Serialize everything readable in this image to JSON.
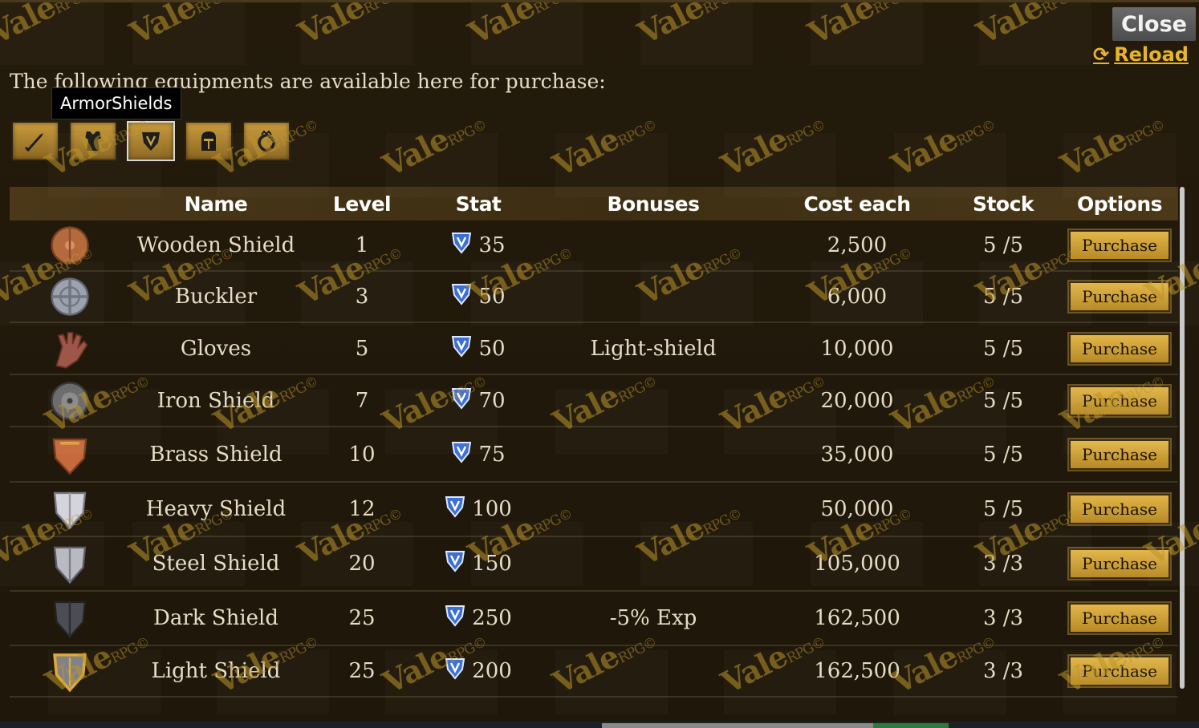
{
  "header": {
    "close_label": "Close",
    "reload_label": "Reload",
    "intro_text": "The following equipments are available here for purchase:"
  },
  "tooltip": {
    "hidden_label": "Armor",
    "label": "Shields"
  },
  "categories": [
    {
      "name": "Weapons",
      "icon": "dagger-icon"
    },
    {
      "name": "Armor",
      "icon": "armor-icon"
    },
    {
      "name": "Shields",
      "icon": "shield-icon",
      "active": true
    },
    {
      "name": "Helmets",
      "icon": "helmet-icon"
    },
    {
      "name": "Accessories",
      "icon": "ring-icon"
    }
  ],
  "table": {
    "headers": [
      "Name",
      "Level",
      "Stat",
      "Bonuses",
      "Cost each",
      "Stock",
      "Options"
    ],
    "rows": [
      {
        "icon": "wooden-shield-icon",
        "name": "Wooden Shield",
        "level": "1",
        "stat": "35",
        "bonuses": "",
        "cost": "2,500",
        "stock": "5 /5",
        "option": "Purchase"
      },
      {
        "icon": "buckler-icon",
        "name": "Buckler",
        "level": "3",
        "stat": "50",
        "bonuses": "",
        "cost": "6,000",
        "stock": "5 /5",
        "option": "Purchase"
      },
      {
        "icon": "gloves-icon",
        "name": "Gloves",
        "level": "5",
        "stat": "50",
        "bonuses": "Light-shield",
        "cost": "10,000",
        "stock": "5 /5",
        "option": "Purchase"
      },
      {
        "icon": "iron-shield-icon",
        "name": "Iron Shield",
        "level": "7",
        "stat": "70",
        "bonuses": "",
        "cost": "20,000",
        "stock": "5 /5",
        "option": "Purchase"
      },
      {
        "icon": "brass-shield-icon",
        "name": "Brass Shield",
        "level": "10",
        "stat": "75",
        "bonuses": "",
        "cost": "35,000",
        "stock": "5 /5",
        "option": "Purchase"
      },
      {
        "icon": "heavy-shield-icon",
        "name": "Heavy Shield",
        "level": "12",
        "stat": "100",
        "bonuses": "",
        "cost": "50,000",
        "stock": "5 /5",
        "option": "Purchase"
      },
      {
        "icon": "steel-shield-icon",
        "name": "Steel Shield",
        "level": "20",
        "stat": "150",
        "bonuses": "",
        "cost": "105,000",
        "stock": "3 /3",
        "option": "Purchase"
      },
      {
        "icon": "dark-shield-icon",
        "name": "Dark Shield",
        "level": "25",
        "stat": "250",
        "bonuses": "-5% Exp",
        "cost": "162,500",
        "stock": "3 /3",
        "option": "Purchase"
      },
      {
        "icon": "light-shield-icon",
        "name": "Light Shield",
        "level": "25",
        "stat": "200",
        "bonuses": "",
        "cost": "162,500",
        "stock": "3 /3",
        "option": "Purchase"
      }
    ]
  },
  "watermark": {
    "brand": "Vale",
    "suffix": "RPG©"
  },
  "colors": {
    "accent": "#e8b52a",
    "button": "#d4a63c",
    "background": "#231a0b"
  }
}
